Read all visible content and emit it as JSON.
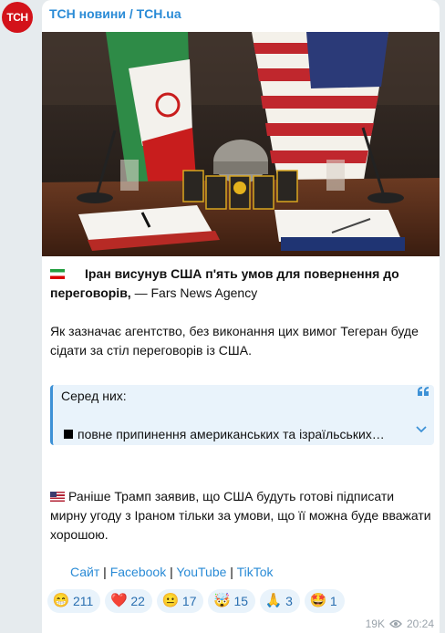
{
  "avatar_text": "ТСН",
  "channel_name": "ТСН новини / TCH.ua",
  "post": {
    "headline_bold": "Іран висунув США п'ять умов для повернення до переговорів,",
    "headline_rest": " — Fars News Agency",
    "paragraph1": "Як зазначає агентство, без виконання цих вимог Тегеран буде сідати за стіл переговорів із США.",
    "quote_title": "Серед них:",
    "quote_first_item": "повне припинення американських та ізраїльських…",
    "paragraph2": "Раніше Трамп заявив, що США будуть готові підписати мирну угоду з Іраном тільки за умови, що її можна буде вважати хорошою."
  },
  "links": {
    "site": "Сайт",
    "facebook": "Facebook",
    "youtube": "YouTube",
    "tiktok": "TikTok",
    "separator": " | "
  },
  "reactions": [
    {
      "emoji": "😁",
      "icon": "grinning-face-icon",
      "count": "211"
    },
    {
      "emoji": "❤️",
      "icon": "red-heart-icon",
      "count": "22"
    },
    {
      "emoji": "😐",
      "icon": "neutral-face-icon",
      "count": "17"
    },
    {
      "emoji": "🤯",
      "icon": "exploding-head-icon",
      "count": "15"
    },
    {
      "emoji": "🙏",
      "icon": "folded-hands-icon",
      "count": "3"
    },
    {
      "emoji": "🤩",
      "icon": "star-struck-icon",
      "count": "1"
    }
  ],
  "meta": {
    "views": "19K",
    "time": "20:24"
  },
  "colors": {
    "accent": "#2a8bd6",
    "avatar_bg": "#d3121a",
    "quote_bg": "#e9f3fb",
    "background": "#e6ebee"
  }
}
